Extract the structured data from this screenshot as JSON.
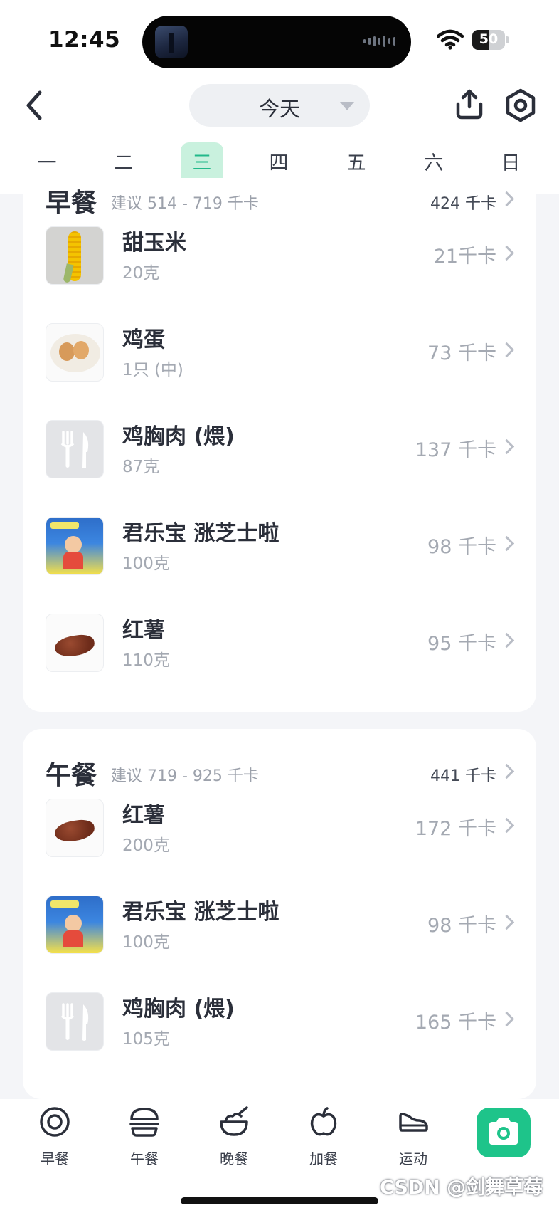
{
  "status": {
    "time": "12:45",
    "battery": "50",
    "battery_level": 0.5
  },
  "nav": {
    "date_label": "今天"
  },
  "week": {
    "days": [
      "一",
      "二",
      "三",
      "四",
      "五",
      "六",
      "日"
    ],
    "active_index": 2
  },
  "breakfast": {
    "title": "早餐",
    "suggest": "建议 514 - 719 千卡",
    "total": "424 千卡",
    "items": [
      {
        "name": "甜玉米",
        "qty": "20克",
        "cal": "21千卡",
        "thumb": "corn"
      },
      {
        "name": "鸡蛋",
        "qty": "1只 (中)",
        "cal": "73 千卡",
        "thumb": "egg"
      },
      {
        "name": "鸡胸肉 (煨)",
        "qty": "87克",
        "cal": "137 千卡",
        "thumb": "fork-knife"
      },
      {
        "name": "君乐宝 涨芝士啦",
        "qty": "100克",
        "cal": "98 千卡",
        "thumb": "yogurt"
      },
      {
        "name": "红薯",
        "qty": "110克",
        "cal": "95 千卡",
        "thumb": "sweet-potato"
      }
    ]
  },
  "lunch": {
    "title": "午餐",
    "suggest": "建议 719 - 925 千卡",
    "total": "441 千卡",
    "items": [
      {
        "name": "红薯",
        "qty": "200克",
        "cal": "172 千卡",
        "thumb": "sweet-potato"
      },
      {
        "name": "君乐宝 涨芝士啦",
        "qty": "100克",
        "cal": "98 千卡",
        "thumb": "yogurt"
      },
      {
        "name": "鸡胸肉 (煨)",
        "qty": "105克",
        "cal": "165 千卡",
        "thumb": "fork-knife"
      }
    ]
  },
  "tabbar": {
    "tabs": [
      {
        "label": "早餐",
        "icon": "plate-icon"
      },
      {
        "label": "午餐",
        "icon": "burger-icon"
      },
      {
        "label": "晚餐",
        "icon": "bowl-icon"
      },
      {
        "label": "加餐",
        "icon": "apple-icon"
      },
      {
        "label": "运动",
        "icon": "shoe-icon"
      }
    ],
    "camera_icon": "camera-icon"
  },
  "watermark": "CSDN @剑舞草莓",
  "colors": {
    "accent": "#1ec48a",
    "active_day_bg": "#c9f1de",
    "active_day_text": "#21b98a"
  }
}
